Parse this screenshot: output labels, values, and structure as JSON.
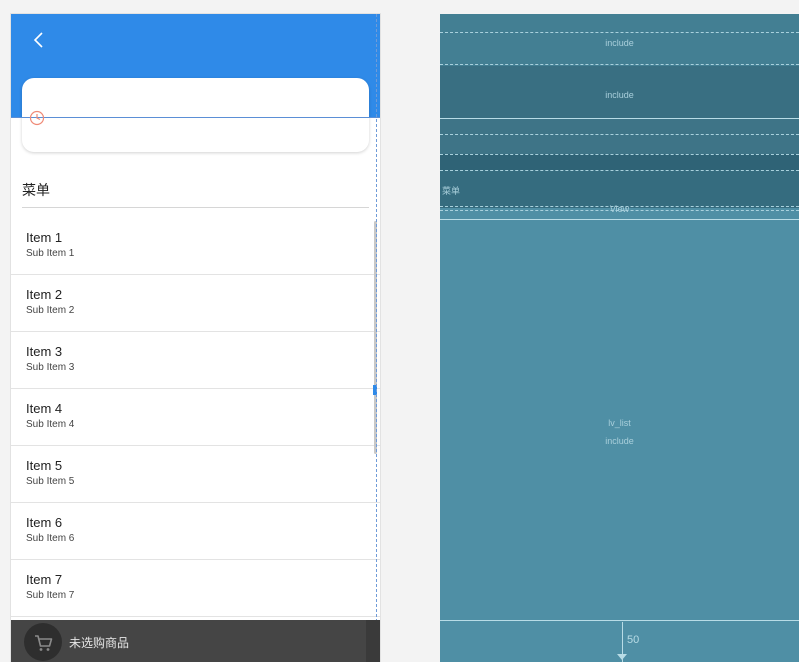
{
  "preview": {
    "menu_header": "菜单",
    "list_items": [
      {
        "title": "Item 1",
        "subtitle": "Sub Item 1"
      },
      {
        "title": "Item 2",
        "subtitle": "Sub Item 2"
      },
      {
        "title": "Item 3",
        "subtitle": "Sub Item 3"
      },
      {
        "title": "Item 4",
        "subtitle": "Sub Item 4"
      },
      {
        "title": "Item 5",
        "subtitle": "Sub Item 5"
      },
      {
        "title": "Item 6",
        "subtitle": "Sub Item 6"
      },
      {
        "title": "Item 7",
        "subtitle": "Sub Item 7"
      }
    ],
    "cart_text": "未选购商品",
    "colors": {
      "appbar": "#2f8ae8",
      "cart_bar": "#454545"
    },
    "icons": {
      "back": "chevron-left-icon",
      "clock": "clock-icon",
      "cart": "cart-icon"
    }
  },
  "blueprint": {
    "include_top_1": "include",
    "include_top_2": "include",
    "menu_label": "菜单",
    "view_label": "View",
    "list_id": "lv_list",
    "list_include": "include",
    "height_value": "50",
    "colors": {
      "background": "#4f8fa5",
      "lines": "#a9d1dd"
    }
  }
}
